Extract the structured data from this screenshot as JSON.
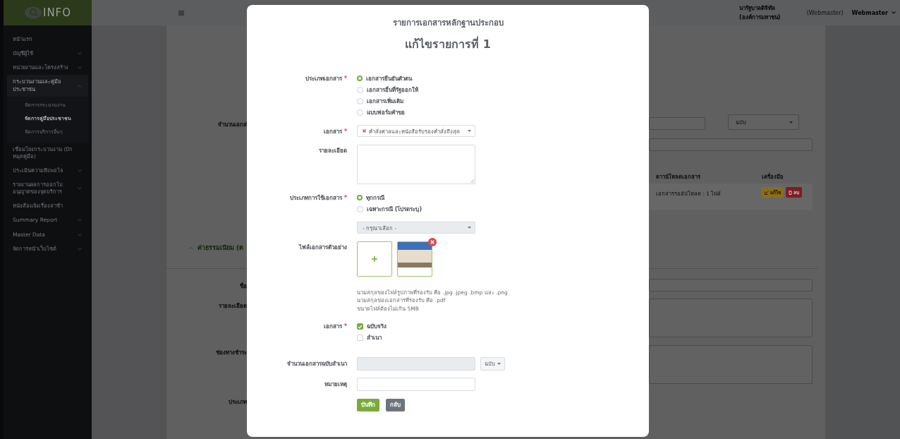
{
  "sidebar": {
    "logo": "INFO",
    "items": [
      {
        "label": "หน้าแรก",
        "selected": false
      },
      {
        "label": "บัญชีผู้ใช้",
        "selected": false,
        "expanded": false
      },
      {
        "label": "หน่วยงานและโครงสร้าง",
        "selected": false,
        "expanded": false
      },
      {
        "label": "กระบวนงานและคู่มือประชาชน",
        "selected": true,
        "expanded": true,
        "children": [
          {
            "label": "จัดการกระบวนงาน",
            "selected": false
          },
          {
            "label": "จัดการคู่มือประชาชน",
            "selected": true
          },
          {
            "label": "จัดการบริการอื่นๆ",
            "selected": false
          }
        ]
      },
      {
        "label": "เชื่อมโยงกระบวนงาน (ปักหมุดคู่มือ)",
        "selected": false
      },
      {
        "label": "ประเมินความพึงพอใจ",
        "selected": false,
        "expanded": false
      },
      {
        "label": "รายงานผลการออกใบอนุญาตของจุดบริการ",
        "selected": false,
        "expanded": false
      },
      {
        "label": "หนังสือแจ้งเรื่องล่าช้า",
        "selected": false
      },
      {
        "label": "Summary Report",
        "selected": false,
        "expanded": false
      },
      {
        "label": "Master Data",
        "selected": false,
        "expanded": false
      },
      {
        "label": "จัดการหน้าเว็บไซต์",
        "selected": false,
        "expanded": false
      }
    ]
  },
  "topbar": {
    "organization": "นารัฐบาลดิจิทัล (องค์การมหาชน)",
    "role": "(Webmaster)",
    "user": "Webmaster"
  },
  "background_form": {
    "copies_label": "จำนวนเอกส",
    "copies_unit": "ฉบับ",
    "table": {
      "columns": [
        "ดาวน์โหลดเอกสาร",
        "เครื่องมือ"
      ],
      "rows": [
        {
          "download": "เอกสารรออัปโหลด : 1 ไฟล์",
          "actions": [
            "แก้ไข",
            "ลบ"
          ]
        }
      ]
    },
    "section": "ค่าธรรมเนียม (ต",
    "labels": [
      "ชื่อ",
      "รายละเอียด",
      "ช่องทางชำระ",
      "ประเภท"
    ]
  },
  "modal": {
    "title": "รายการเอกสารหลักฐานประกอบ",
    "heading": "แก้ไขรายการที่ 1",
    "fields": [
      {
        "kind": "radio",
        "label": "ประเภทเอกสาร",
        "required": true,
        "options": [
          {
            "label": "เอกสารยืนยันตัวตน",
            "selected": true
          },
          {
            "label": "เอกสารอื่นที่รัฐออกให้",
            "selected": false
          },
          {
            "label": "เอกสารเพิ่มเติม",
            "selected": false
          },
          {
            "label": "แบบฟอร์มคำขอ",
            "selected": false
          }
        ]
      },
      {
        "kind": "select",
        "label": "เอกสาร",
        "required": true,
        "value": "คำสั่งศาลและหนังสือรับรองคำสั่งถึงสุด",
        "clearable": true,
        "disabled": false
      },
      {
        "kind": "textarea",
        "label": "รายละเอียด",
        "required": false
      },
      {
        "kind": "radio",
        "label": "ประเภทการใช้เอกสาร",
        "required": true,
        "options": [
          {
            "label": "ทุกกรณี",
            "selected": true
          },
          {
            "label": "เฉพาะกรณี (โปรดระบุ)",
            "selected": false
          }
        ]
      },
      {
        "kind": "select",
        "value": "- กรุณาเลือก -",
        "clearable": false,
        "disabled": true
      },
      {
        "kind": "files",
        "label": "ไฟล์เอกสารตัวอย่าง",
        "required": false,
        "files": [
          {
            "removable": true
          }
        ],
        "hints": [
          "นามสกุลของไฟล์รูปภาพที่รองรับ คือ .jpg .jpeg .bmp และ .png",
          "นามสกุลของเอกสารที่รองรับ คือ .pdf",
          "ขนาดไฟล์ต้องไม่เกิน 5MB"
        ]
      },
      {
        "kind": "checkbox",
        "label": "เอกสาร",
        "required": true,
        "options": [
          {
            "label": "ฉบับจริง",
            "checked": true
          },
          {
            "label": "สำเนา",
            "checked": false
          }
        ]
      },
      {
        "kind": "input_unit",
        "label": "จำนวนเอกสารฉบับสำเนา",
        "required": false,
        "disabled": true,
        "unit": "ฉบับ"
      },
      {
        "kind": "input",
        "label": "หมายเหตุ",
        "required": false
      }
    ],
    "buttons": [
      {
        "label": "บันทึก",
        "kind": "primary"
      },
      {
        "label": "กลับ",
        "kind": "secondary"
      }
    ]
  }
}
